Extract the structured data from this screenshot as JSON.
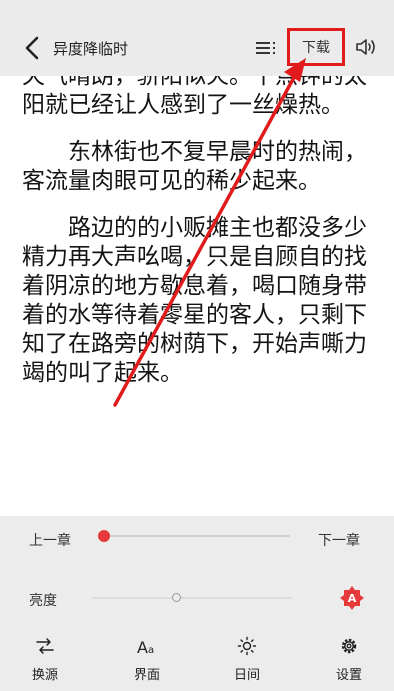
{
  "header": {
    "title": "异度降临时",
    "download_label": "下载"
  },
  "reader": {
    "paragraphs": [
      "天气晴朗，骄阳似火。十点钟的太阳就已经让人感到了一丝燥热。",
      "东林街也不复早晨时的热闹，客流量肉眼可见的稀少起来。",
      "路边的的小贩摊主也都没多少精力再大声吆喝，只是自顾自的找着阴凉的地方歇息着，喝口随身带着的水等待着零星的客人，只剩下知了在路旁的树荫下，开始声嘶力竭的叫了起来。"
    ]
  },
  "panel": {
    "prev_chapter": "上一章",
    "next_chapter": "下一章",
    "chapter_progress": 0.0,
    "brightness_label": "亮度",
    "brightness_level": 0.42,
    "auto_brightness_badge": "A"
  },
  "nav": [
    {
      "label": "换源",
      "icon": "switch-source-icon"
    },
    {
      "label": "界面",
      "icon": "font-aa-icon"
    },
    {
      "label": "日间",
      "icon": "sun-icon"
    },
    {
      "label": "设置",
      "icon": "settings-gear-icon"
    }
  ],
  "colors": {
    "accent": "#e63a3a",
    "highlight_box": "#e11b1b",
    "toolbar_bg": "#ebebeb",
    "panel_bg": "#ececec"
  }
}
